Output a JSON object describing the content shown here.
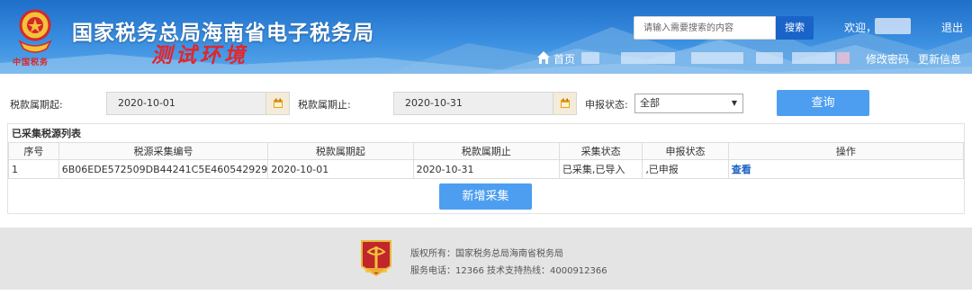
{
  "header": {
    "site_title": "国家税务总局海南省电子税务局",
    "env_label": "测试环境",
    "logo_text": "中国税务",
    "search": {
      "placeholder": "请输入需要搜索的内容",
      "button_label": "搜索"
    },
    "welcome_label": "欢迎，",
    "logout_label": "退出",
    "nav": {
      "home_label": "首页",
      "change_password_label": "修改密码",
      "update_info_label": "更新信息"
    }
  },
  "filter": {
    "start_label": "税款属期起:",
    "start_value": "2020-10-01",
    "end_label": "税款属期止:",
    "end_value": "2020-10-31",
    "status_label": "申报状态:",
    "status_value": "全部",
    "query_label": "查询"
  },
  "table": {
    "title": "已采集税源列表",
    "columns": [
      "序号",
      "税源采集编号",
      "税款属期起",
      "税款属期止",
      "采集状态",
      "申报状态",
      "操作"
    ],
    "rows": [
      {
        "index": "1",
        "code": "6B06EDE572509DB44241C5E460542929",
        "start": "2020-10-01",
        "end": "2020-10-31",
        "collect_status": "已采集,已导入",
        "declare_status": ",已申报",
        "action": "查看"
      }
    ],
    "add_label": "新增采集"
  },
  "footer": {
    "copyright": "版权所有：国家税务总局海南省税务局",
    "service": "服务电话：12366 技术支持热线：4000912366"
  },
  "colors": {
    "header_blue": "#2e7fd6",
    "button_blue": "#4d9ef0",
    "link_blue": "#1a5fc0",
    "env_red": "#e4252b",
    "footer_gray": "#e4e4e4"
  }
}
